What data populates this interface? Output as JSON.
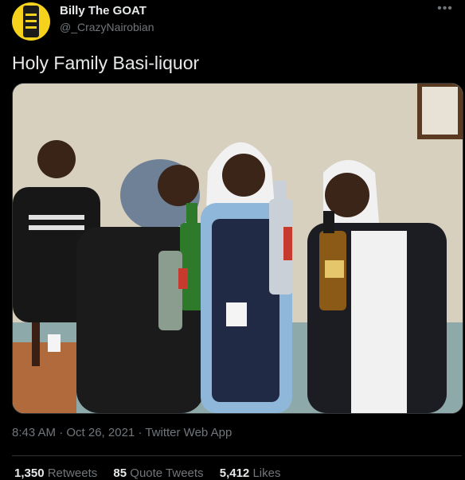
{
  "author": {
    "display_name": "Billy The GOAT",
    "handle": "@_CrazyNairobian",
    "avatar_color": "#f6d21c"
  },
  "tweet": {
    "text": "Holy Family Basi-liquor",
    "timestamp": "8:43 AM · Oct 26, 2021",
    "source": "Twitter Web App"
  },
  "icons": {
    "more": "more-horizontal-icon"
  },
  "stats": {
    "retweets_count": "1,350",
    "retweets_label": "Retweets",
    "quote_count": "85",
    "quote_label": "Quote Tweets",
    "likes_count": "5,412",
    "likes_label": "Likes"
  },
  "colors": {
    "background": "#000000",
    "text_primary": "#e7e9ea",
    "text_secondary": "#71767b",
    "border": "#2f3336"
  }
}
